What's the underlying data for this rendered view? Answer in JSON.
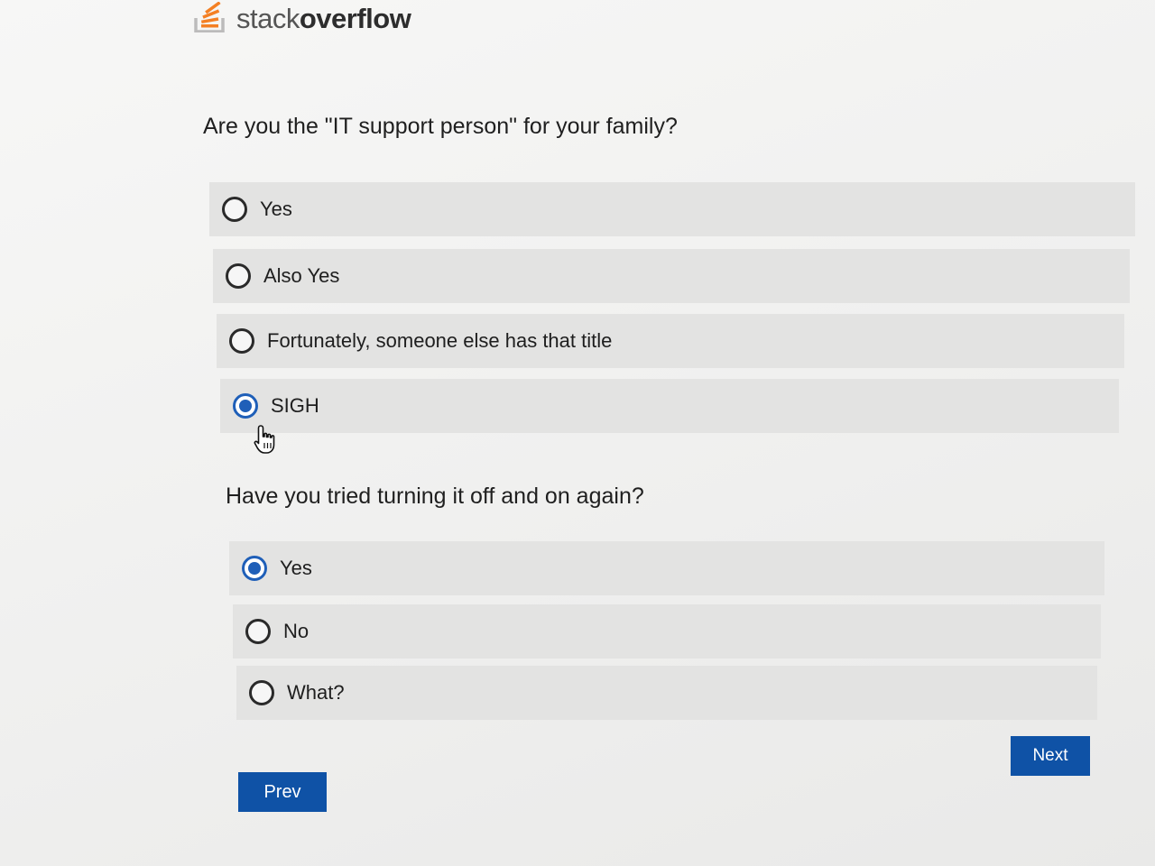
{
  "brand": {
    "logo_icon": "stack-overflow-logo-icon",
    "word_light": "stack",
    "word_bold": "overflow",
    "accent_color": "#f48024"
  },
  "questions": [
    {
      "text": "Are you the \"IT support person\" for your family?",
      "options": [
        {
          "label": "Yes",
          "selected": false
        },
        {
          "label": "Also Yes",
          "selected": false
        },
        {
          "label": "Fortunately, someone else has that title",
          "selected": false
        },
        {
          "label": "SIGH",
          "selected": true
        }
      ]
    },
    {
      "text": "Have you tried turning it off and on again?",
      "options": [
        {
          "label": "Yes",
          "selected": true
        },
        {
          "label": "No",
          "selected": false
        },
        {
          "label": "What?",
          "selected": false
        }
      ]
    }
  ],
  "navigation": {
    "prev_label": "Prev",
    "next_label": "Next",
    "button_color": "#0f52a6"
  },
  "cursor": {
    "icon": "hand-pointer-icon"
  }
}
